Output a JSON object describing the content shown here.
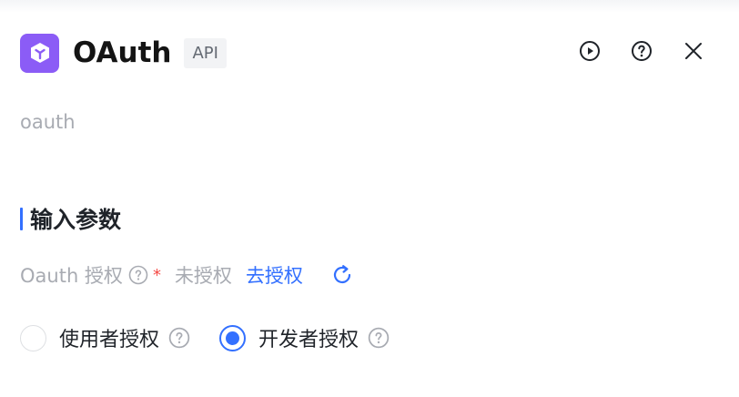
{
  "header": {
    "icon": "app-logo-icon",
    "title": "OAuth",
    "badge": "API",
    "actions": [
      "play-circle-icon",
      "help-circle-icon",
      "close-icon"
    ]
  },
  "description": "oauth",
  "section": {
    "title": "输入参数"
  },
  "oauth_field": {
    "label": "Oauth 授权",
    "required_mark": "*",
    "status": "未授权",
    "authorize_link": "去授权",
    "refresh_icon": "refresh-icon"
  },
  "auth_options": [
    {
      "label": "使用者授权",
      "selected": false
    },
    {
      "label": "开发者授权",
      "selected": true
    }
  ],
  "colors": {
    "accent": "#3370ff",
    "brand": "#8b5cf6",
    "required": "#f54a45",
    "muted": "#a8abb2"
  }
}
